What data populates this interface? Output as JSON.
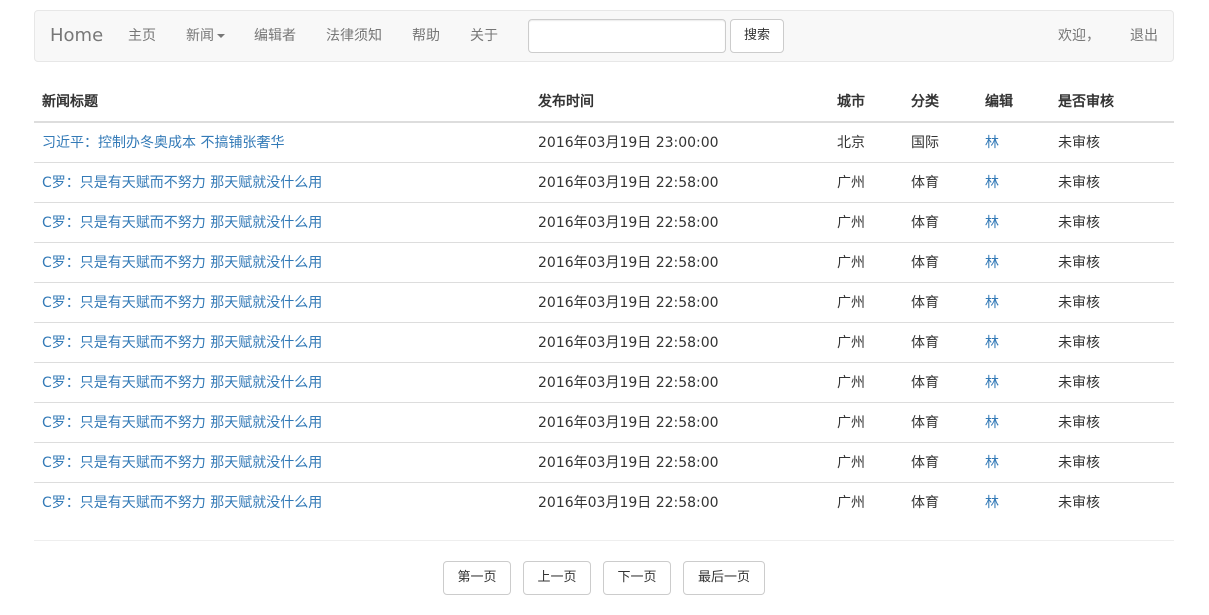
{
  "navbar": {
    "brand": "Home",
    "items": [
      "主页",
      "新闻",
      "编辑者",
      "法律须知",
      "帮助",
      "关于"
    ],
    "search": {
      "value": "",
      "placeholder": "",
      "button": "搜索"
    },
    "welcome": "欢迎，",
    "logout": "退出"
  },
  "table": {
    "headers": [
      "新闻标题",
      "发布时间",
      "城市",
      "分类",
      "编辑",
      "是否审核"
    ],
    "rows": [
      {
        "title": "习近平：控制办冬奥成本 不搞铺张奢华",
        "time": "2016年03月19日 23:00:00",
        "city": "北京",
        "category": "国际",
        "editor": "林",
        "status": "未审核"
      },
      {
        "title": "C罗：只是有天赋而不努力 那天赋就没什么用",
        "time": "2016年03月19日 22:58:00",
        "city": "广州",
        "category": "体育",
        "editor": "林",
        "status": "未审核"
      },
      {
        "title": "C罗：只是有天赋而不努力 那天赋就没什么用",
        "time": "2016年03月19日 22:58:00",
        "city": "广州",
        "category": "体育",
        "editor": "林",
        "status": "未审核"
      },
      {
        "title": "C罗：只是有天赋而不努力 那天赋就没什么用",
        "time": "2016年03月19日 22:58:00",
        "city": "广州",
        "category": "体育",
        "editor": "林",
        "status": "未审核"
      },
      {
        "title": "C罗：只是有天赋而不努力 那天赋就没什么用",
        "time": "2016年03月19日 22:58:00",
        "city": "广州",
        "category": "体育",
        "editor": "林",
        "status": "未审核"
      },
      {
        "title": "C罗：只是有天赋而不努力 那天赋就没什么用",
        "time": "2016年03月19日 22:58:00",
        "city": "广州",
        "category": "体育",
        "editor": "林",
        "status": "未审核"
      },
      {
        "title": "C罗：只是有天赋而不努力 那天赋就没什么用",
        "time": "2016年03月19日 22:58:00",
        "city": "广州",
        "category": "体育",
        "editor": "林",
        "status": "未审核"
      },
      {
        "title": "C罗：只是有天赋而不努力 那天赋就没什么用",
        "time": "2016年03月19日 22:58:00",
        "city": "广州",
        "category": "体育",
        "editor": "林",
        "status": "未审核"
      },
      {
        "title": "C罗：只是有天赋而不努力 那天赋就没什么用",
        "time": "2016年03月19日 22:58:00",
        "city": "广州",
        "category": "体育",
        "editor": "林",
        "status": "未审核"
      },
      {
        "title": "C罗：只是有天赋而不努力 那天赋就没什么用",
        "time": "2016年03月19日 22:58:00",
        "city": "广州",
        "category": "体育",
        "editor": "林",
        "status": "未审核"
      }
    ]
  },
  "pager": {
    "first": "第一页",
    "prev": "上一页",
    "next": "下一页",
    "last": "最后一页"
  },
  "colors": {
    "link": "#337ab7",
    "navbar_bg": "#f8f8f8",
    "nav_text": "#777777"
  },
  "icons": {
    "dropdown": "caret-down-icon"
  }
}
